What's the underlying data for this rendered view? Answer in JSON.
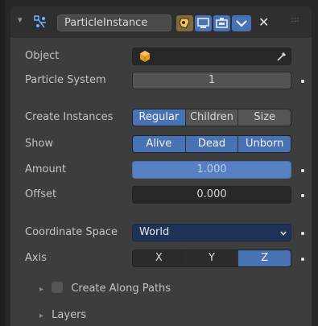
{
  "header": {
    "modifier_name": "ParticleInstance",
    "collapse_glyph": "▾",
    "modifier_icon": "particle-instance-icon",
    "close_glyph": "✕",
    "drag_glyph": "::::"
  },
  "props": {
    "object_label": "Object",
    "particle_system_label": "Particle System",
    "particle_system_value": "1",
    "create_instances_label": "Create Instances",
    "create_instances_options": [
      "Regular",
      "Children",
      "Size"
    ],
    "show_label": "Show",
    "show_options": [
      "Alive",
      "Dead",
      "Unborn"
    ],
    "amount_label": "Amount",
    "amount_value": "1.000",
    "offset_label": "Offset",
    "offset_value": "0.000",
    "coordinate_space_label": "Coordinate Space",
    "coordinate_space_value": "World",
    "axis_label": "Axis",
    "axis_options": [
      "X",
      "Y",
      "Z"
    ]
  },
  "subpanels": {
    "create_along_paths_label": "Create Along Paths",
    "layers_label": "Layers",
    "expand_glyph": "▸"
  },
  "colors": {
    "accent": "#4772b3",
    "amount_fill": "#5680c2",
    "dropdown_bg": "#1f3257"
  }
}
